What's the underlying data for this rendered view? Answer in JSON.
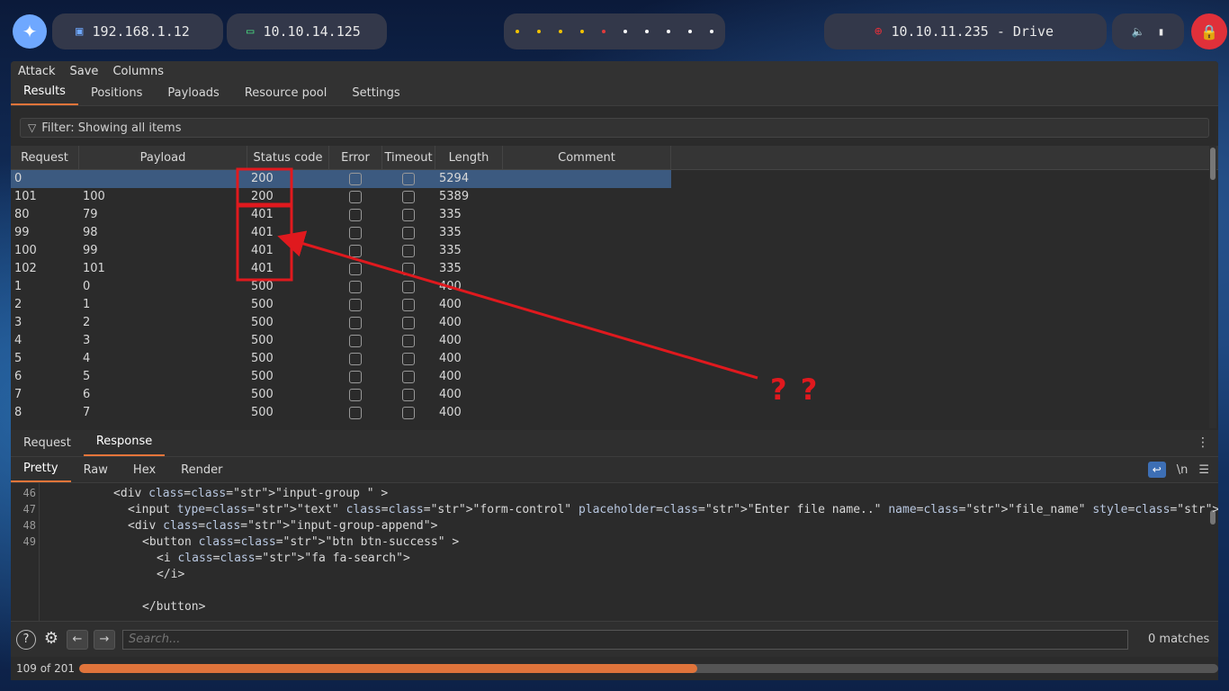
{
  "topbar": {
    "logo_icon": "kali-dragon-icon",
    "ip_local": "192.168.1.12",
    "ip_vpn": "10.10.14.125",
    "target": "10.10.11.235 - Drive",
    "workspace_dots": [
      "#f2c200",
      "#f2c200",
      "#f2c200",
      "#f2c200",
      "#e03b3b",
      "#ffffff",
      "#ffffff",
      "#ffffff",
      "#ffffff",
      "#ffffff"
    ],
    "accent_red": "#e0303a"
  },
  "menu": [
    "Attack",
    "Save",
    "Columns"
  ],
  "tabs": [
    "Results",
    "Positions",
    "Payloads",
    "Resource pool",
    "Settings"
  ],
  "filter": {
    "label": "Filter: Showing all items"
  },
  "table": {
    "headers": [
      "Request",
      "Payload",
      "Status code",
      "Error",
      "Timeout",
      "Length",
      "Comment"
    ],
    "sort_indicator": "^",
    "rows": [
      {
        "request": "0",
        "payload": "",
        "status": "200",
        "length": "5294"
      },
      {
        "request": "101",
        "payload": "100",
        "status": "200",
        "length": "5389"
      },
      {
        "request": "80",
        "payload": "79",
        "status": "401",
        "length": "335"
      },
      {
        "request": "99",
        "payload": "98",
        "status": "401",
        "length": "335"
      },
      {
        "request": "100",
        "payload": "99",
        "status": "401",
        "length": "335"
      },
      {
        "request": "102",
        "payload": "101",
        "status": "401",
        "length": "335"
      },
      {
        "request": "1",
        "payload": "0",
        "status": "500",
        "length": "400"
      },
      {
        "request": "2",
        "payload": "1",
        "status": "500",
        "length": "400"
      },
      {
        "request": "3",
        "payload": "2",
        "status": "500",
        "length": "400"
      },
      {
        "request": "4",
        "payload": "3",
        "status": "500",
        "length": "400"
      },
      {
        "request": "5",
        "payload": "4",
        "status": "500",
        "length": "400"
      },
      {
        "request": "6",
        "payload": "5",
        "status": "500",
        "length": "400"
      },
      {
        "request": "7",
        "payload": "6",
        "status": "500",
        "length": "400"
      },
      {
        "request": "8",
        "payload": "7",
        "status": "500",
        "length": "400"
      }
    ]
  },
  "lower": {
    "tabs": [
      "Request",
      "Response"
    ],
    "view_tabs": [
      "Pretty",
      "Raw",
      "Hex",
      "Render"
    ],
    "newline_toggle": "\\n",
    "code_lines": [
      {
        "num": "46",
        "indent": 8,
        "html": "<div class=\"input-group \" >"
      },
      {
        "num": "47",
        "indent": 10,
        "html": "<input type=\"text\" class=\"form-control\" placeholder=\"Enter file name..\" name=\"file_name\" style=\"\">"
      },
      {
        "num": "48",
        "indent": 10,
        "html": "<div class=\"input-group-append\">"
      },
      {
        "num": "49",
        "indent": 12,
        "html": "<button class=\"btn btn-success\" >"
      },
      {
        "num": "",
        "indent": 14,
        "html": "<i class=\"fa fa-search\">"
      },
      {
        "num": "",
        "indent": 14,
        "html": "</i>"
      },
      {
        "num": "",
        "indent": 0,
        "html": ""
      },
      {
        "num": "",
        "indent": 12,
        "html": "</button>"
      }
    ],
    "search_placeholder": "Search...",
    "matches": "0 matches",
    "progress_label": "109 of 201",
    "progress": {
      "done": 109,
      "total": 201
    }
  },
  "annotation": {
    "text": "? ?",
    "color": "#e0191e"
  }
}
